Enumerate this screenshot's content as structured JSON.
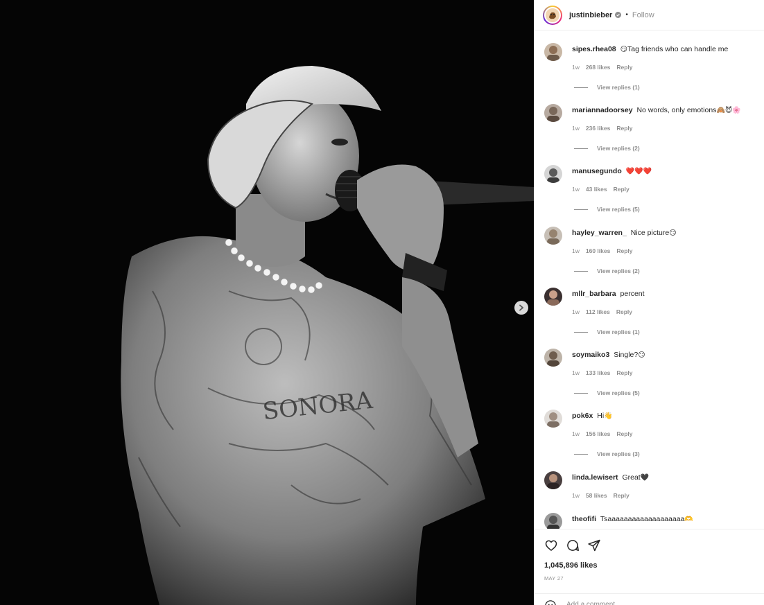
{
  "post": {
    "owner": {
      "username": "justinbieber",
      "verified": true,
      "follow_label": "Follow",
      "separator": "•"
    },
    "media": {
      "next_icon": "chevron-right-icon"
    }
  },
  "comments": [
    {
      "username": "sipes.rhea08",
      "prefix_emoji": "😏",
      "text": "Tag friends who can handle me",
      "suffix_emoji": "",
      "time": "1w",
      "likes": "268 likes",
      "reply_label": "Reply",
      "replies": "View replies (1)"
    },
    {
      "username": "mariannadoorsey",
      "prefix_emoji": "",
      "text": "No words, only emotions",
      "suffix_emoji": "🙈😈🌸",
      "time": "1w",
      "likes": "236 likes",
      "reply_label": "Reply",
      "replies": "View replies (2)"
    },
    {
      "username": "manusegundo",
      "prefix_emoji": "",
      "text": "",
      "suffix_emoji": "❤️❤️❤️",
      "time": "1w",
      "likes": "43 likes",
      "reply_label": "Reply",
      "replies": "View replies (5)"
    },
    {
      "username": "hayley_warren_",
      "prefix_emoji": "",
      "text": "Nice picture",
      "suffix_emoji": "😏",
      "time": "1w",
      "likes": "160 likes",
      "reply_label": "Reply",
      "replies": "View replies (2)"
    },
    {
      "username": "mllr_barbara",
      "prefix_emoji": "",
      "text": "percent",
      "suffix_emoji": "",
      "time": "1w",
      "likes": "112 likes",
      "reply_label": "Reply",
      "replies": "View replies (1)"
    },
    {
      "username": "soymaiko3",
      "prefix_emoji": "",
      "text": "Single?",
      "suffix_emoji": "😏",
      "time": "1w",
      "likes": "133 likes",
      "reply_label": "Reply",
      "replies": "View replies (5)"
    },
    {
      "username": "pok6x",
      "prefix_emoji": "",
      "text": "Hi",
      "suffix_emoji": "👋",
      "time": "1w",
      "likes": "156 likes",
      "reply_label": "Reply",
      "replies": "View replies (3)"
    },
    {
      "username": "linda.lewisert",
      "prefix_emoji": "",
      "text": "Great",
      "suffix_emoji": "🖤",
      "time": "1w",
      "likes": "58 likes",
      "reply_label": "Reply",
      "replies": ""
    },
    {
      "username": "theofifi",
      "prefix_emoji": "",
      "text": "Tsaaaaaaaaaaaaaaaaaaa",
      "suffix_emoji": "🫶",
      "time": "",
      "likes": "",
      "reply_label": "",
      "replies": ""
    }
  ],
  "footer": {
    "like_count": "1,045,896 likes",
    "date": "MAY 27",
    "comment_placeholder": "Add a comment...",
    "icons": [
      "heart-icon",
      "comment-icon",
      "share-icon",
      "emoji-icon"
    ]
  }
}
